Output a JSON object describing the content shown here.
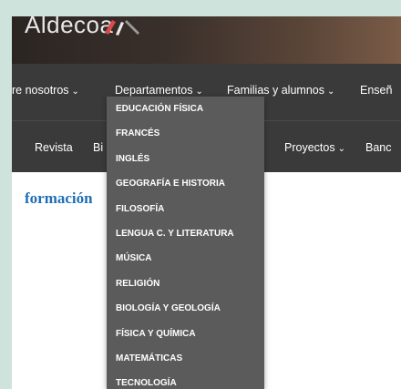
{
  "header": {
    "logo_text": "Aldecoa"
  },
  "nav": {
    "about": "re nosotros",
    "departments": "Departamentos",
    "families": "Familias y alumnos",
    "teaching": "Enseñ",
    "magazine": "Revista",
    "library": "Bi",
    "projects": "Proyectos",
    "bank": "Banc"
  },
  "dropdown": {
    "items": [
      "EDUCACIÓN FÍSICA",
      "FRANCÉS",
      "INGLÉS",
      "GEOGRAFÍA E HISTORIA",
      "FILOSOFÍA",
      "LENGUA C. Y LITERATURA",
      "MÚSICA",
      "RELIGIÓN",
      "BIOLOGÍA Y GEOLOGÍA",
      "FÍSICA Y QUÍMICA",
      "MATEMÁTICAS",
      "TECNOLOGÍA"
    ]
  },
  "content": {
    "heading": "formación"
  }
}
